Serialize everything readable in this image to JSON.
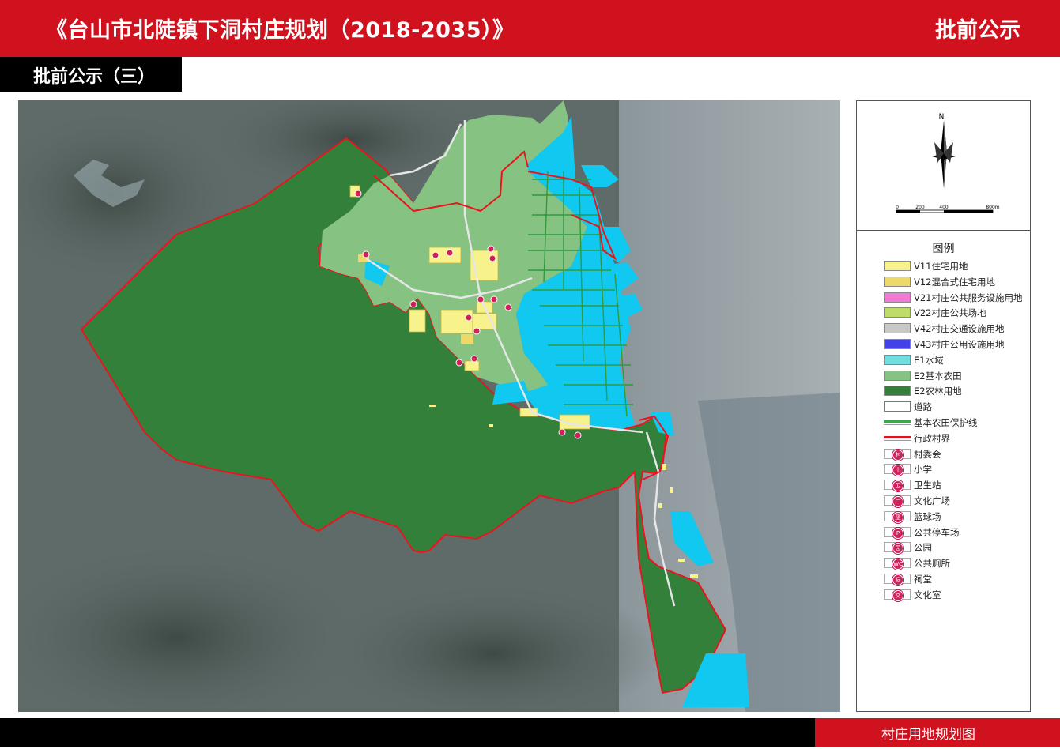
{
  "header": {
    "title": "《台山市北陡镇下洞村庄规划（2018-2035）》",
    "right_label": "批前公示"
  },
  "subheader": {
    "label": "批前公示（三）"
  },
  "footer": {
    "label": "村庄用地规划图"
  },
  "compass": {
    "north": "N"
  },
  "scale": {
    "ticks": [
      "0",
      "200",
      "400",
      "800m"
    ]
  },
  "legend": {
    "title": "图例",
    "items": [
      {
        "label": "V11住宅用地",
        "color": "#f7f28c",
        "kind": "fill"
      },
      {
        "label": "V12混合式住宅用地",
        "color": "#ecd96a",
        "kind": "fill"
      },
      {
        "label": "V21村庄公共服务设施用地",
        "color": "#f27ad4",
        "kind": "fill"
      },
      {
        "label": "V22村庄公共场地",
        "color": "#bddc6a",
        "kind": "fill"
      },
      {
        "label": "V42村庄交通设施用地",
        "color": "#c8c8c8",
        "kind": "fill"
      },
      {
        "label": "V43村庄公用设施用地",
        "color": "#4242e6",
        "kind": "fill"
      },
      {
        "label": "E1水域",
        "color": "#72dde0",
        "kind": "fill"
      },
      {
        "label": "E2基本农田",
        "color": "#86c282",
        "kind": "fill"
      },
      {
        "label": "E2农林用地",
        "color": "#33803a",
        "kind": "fill"
      },
      {
        "label": "道路",
        "color": "#ffffff",
        "kind": "road"
      },
      {
        "label": "基本农田保护线",
        "color": "#3da84a",
        "kind": "line-green"
      },
      {
        "label": "行政村界",
        "color": "#d8141c",
        "kind": "line-red"
      },
      {
        "label": "村委会",
        "kind": "symbol",
        "glyph": "村"
      },
      {
        "label": "小学",
        "kind": "symbol",
        "glyph": "小"
      },
      {
        "label": "卫生站",
        "kind": "symbol",
        "glyph": "卫"
      },
      {
        "label": "文化广场",
        "kind": "symbol",
        "glyph": "广"
      },
      {
        "label": "篮球场",
        "kind": "symbol",
        "glyph": "篮"
      },
      {
        "label": "公共停车场",
        "kind": "symbol",
        "glyph": "P"
      },
      {
        "label": "公园",
        "kind": "symbol",
        "glyph": "园"
      },
      {
        "label": "公共厕所",
        "kind": "symbol",
        "glyph": "WC"
      },
      {
        "label": "祠堂",
        "kind": "symbol",
        "glyph": "祠"
      },
      {
        "label": "文化室",
        "kind": "symbol",
        "glyph": "文"
      }
    ]
  },
  "colors": {
    "header_red": "#d0121e",
    "forest": "#33803a",
    "farmland": "#86c282",
    "water": "#11c8f0",
    "boundary": "#d8141c"
  }
}
